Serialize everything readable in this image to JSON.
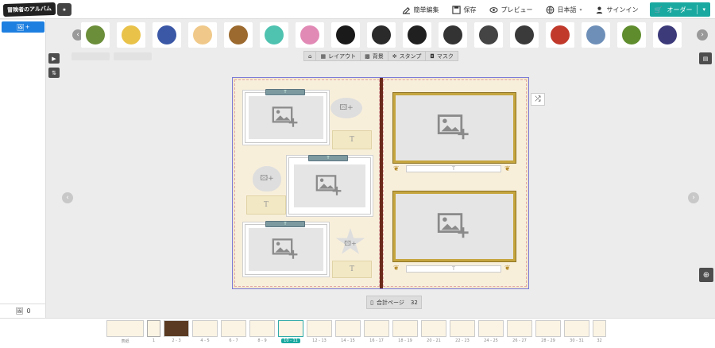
{
  "header": {
    "logo_text": "冒険者のアルバム",
    "nav": [
      {
        "label": "簡単編集",
        "icon": "edit-icon"
      },
      {
        "label": "保存",
        "icon": "save-icon"
      },
      {
        "label": "プレビュー",
        "icon": "eye-icon"
      },
      {
        "label": "日本語",
        "icon": "globe-icon"
      },
      {
        "label": "サインイン",
        "icon": "user-icon"
      }
    ],
    "order_label": "オーダー"
  },
  "stamps": [
    {
      "name": "stamp-1",
      "color": "#6b8e3a"
    },
    {
      "name": "stamp-2",
      "color": "#e9c24a"
    },
    {
      "name": "stamp-3",
      "color": "#3b58a6"
    },
    {
      "name": "stamp-4",
      "color": "#f0c98a"
    },
    {
      "name": "stamp-5",
      "color": "#9c6a2f"
    },
    {
      "name": "stamp-6",
      "color": "#4fc2b0"
    },
    {
      "name": "stamp-7",
      "color": "#e28ab6"
    },
    {
      "name": "stamp-8",
      "color": "#1a1a1a"
    },
    {
      "name": "stamp-9",
      "color": "#2a2a2a"
    },
    {
      "name": "stamp-10",
      "color": "#202020"
    },
    {
      "name": "stamp-11",
      "color": "#333333"
    },
    {
      "name": "stamp-12",
      "color": "#444444"
    },
    {
      "name": "stamp-13",
      "color": "#3a3a3a"
    },
    {
      "name": "stamp-14",
      "color": "#c0392b"
    },
    {
      "name": "stamp-15",
      "color": "#6e8fb8"
    },
    {
      "name": "stamp-16",
      "color": "#5f8d2e"
    },
    {
      "name": "stamp-17",
      "color": "#3d3a7a"
    }
  ],
  "toolbar": {
    "home_icon": "home-icon",
    "items": [
      {
        "label": "レイアウト",
        "icon": "layout-icon"
      },
      {
        "label": "背景",
        "icon": "background-icon"
      },
      {
        "label": "スタンプ",
        "icon": "stamp-icon"
      },
      {
        "label": "マスク",
        "icon": "mask-icon"
      }
    ]
  },
  "album": {
    "text_placeholder": "T",
    "total_label": "合計ページ",
    "total_value": "32"
  },
  "left_panel": {
    "image_count": "0"
  },
  "filmstrip": {
    "thumbs": [
      {
        "label": "表紙"
      },
      {
        "label": "1"
      },
      {
        "label": "2 - 3"
      },
      {
        "label": "4 - 5"
      },
      {
        "label": "6 - 7"
      },
      {
        "label": "8 - 9"
      },
      {
        "label": "10 - 11",
        "active": true
      },
      {
        "label": "12 - 13"
      },
      {
        "label": "14 - 15"
      },
      {
        "label": "16 - 17"
      },
      {
        "label": "18 - 19"
      },
      {
        "label": "20 - 21"
      },
      {
        "label": "22 - 23"
      },
      {
        "label": "24 - 25"
      },
      {
        "label": "26 - 27"
      },
      {
        "label": "28 - 29"
      },
      {
        "label": "30 - 31"
      },
      {
        "label": "32"
      }
    ]
  },
  "colors": {
    "accent": "#1aa9a0",
    "active_tab": "#1d7fe0",
    "frame_gold": "#c5a53e",
    "spine": "#6b2a1a"
  }
}
